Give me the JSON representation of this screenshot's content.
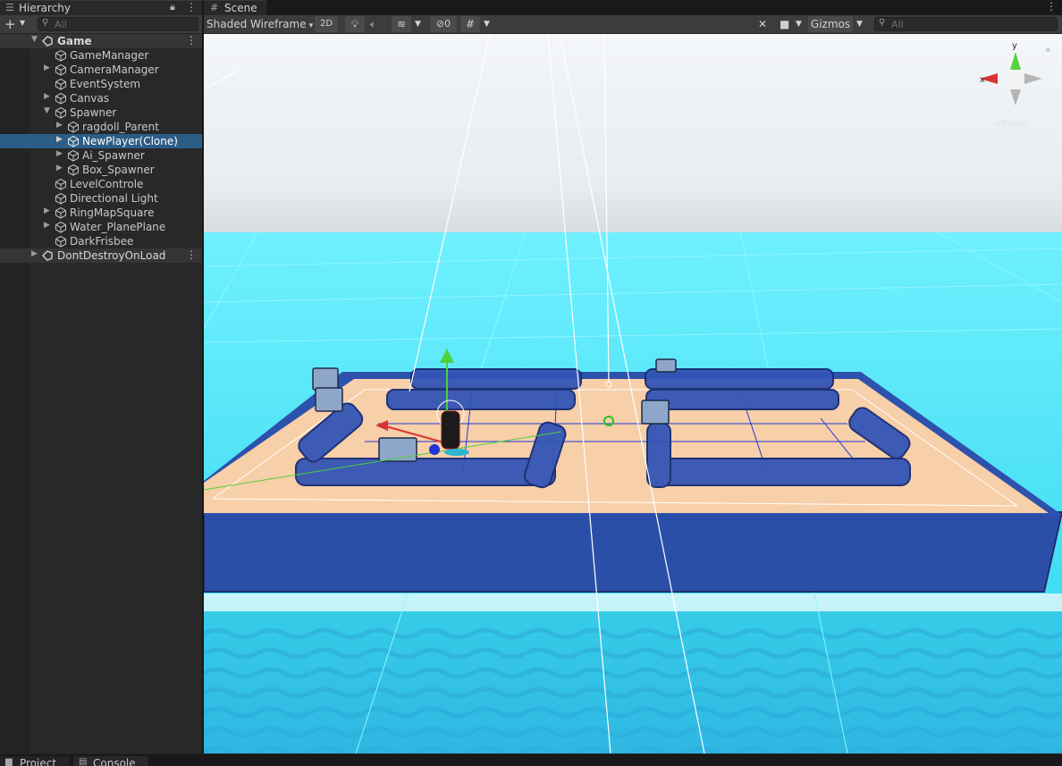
{
  "hierarchy": {
    "title": "Hierarchy",
    "search_placeholder": "All",
    "items": [
      {
        "label": "Game"
      },
      {
        "label": "GameManager"
      },
      {
        "label": "CameraManager"
      },
      {
        "label": "EventSystem"
      },
      {
        "label": "Canvas"
      },
      {
        "label": "Spawner"
      },
      {
        "label": "ragdoll_Parent"
      },
      {
        "label": "NewPlayer(Clone)"
      },
      {
        "label": "Ai_Spawner"
      },
      {
        "label": "Box_Spawner"
      },
      {
        "label": "LevelControle"
      },
      {
        "label": "Directional Light"
      },
      {
        "label": "RingMapSquare"
      },
      {
        "label": "Water_PlanePlane"
      },
      {
        "label": "DarkFrisbee"
      },
      {
        "label": "DontDestroyOnLoad"
      }
    ]
  },
  "scene": {
    "title": "Scene",
    "shading_mode": "Shaded Wireframe",
    "mode_2d": "2D",
    "hidden_count": "0",
    "gizmos": "Gizmos",
    "search_placeholder": "All",
    "axis_y": "y",
    "axis_x": "x",
    "view_label": "<Persp"
  },
  "bottom_tabs": {
    "project": "Project",
    "console": "Console"
  },
  "colors": {
    "selection": "#2c5d87",
    "sky_top": "#ffffff",
    "water": "#4fe3f2",
    "floor": "#f7cfa8",
    "walls": "#2f57b5"
  }
}
